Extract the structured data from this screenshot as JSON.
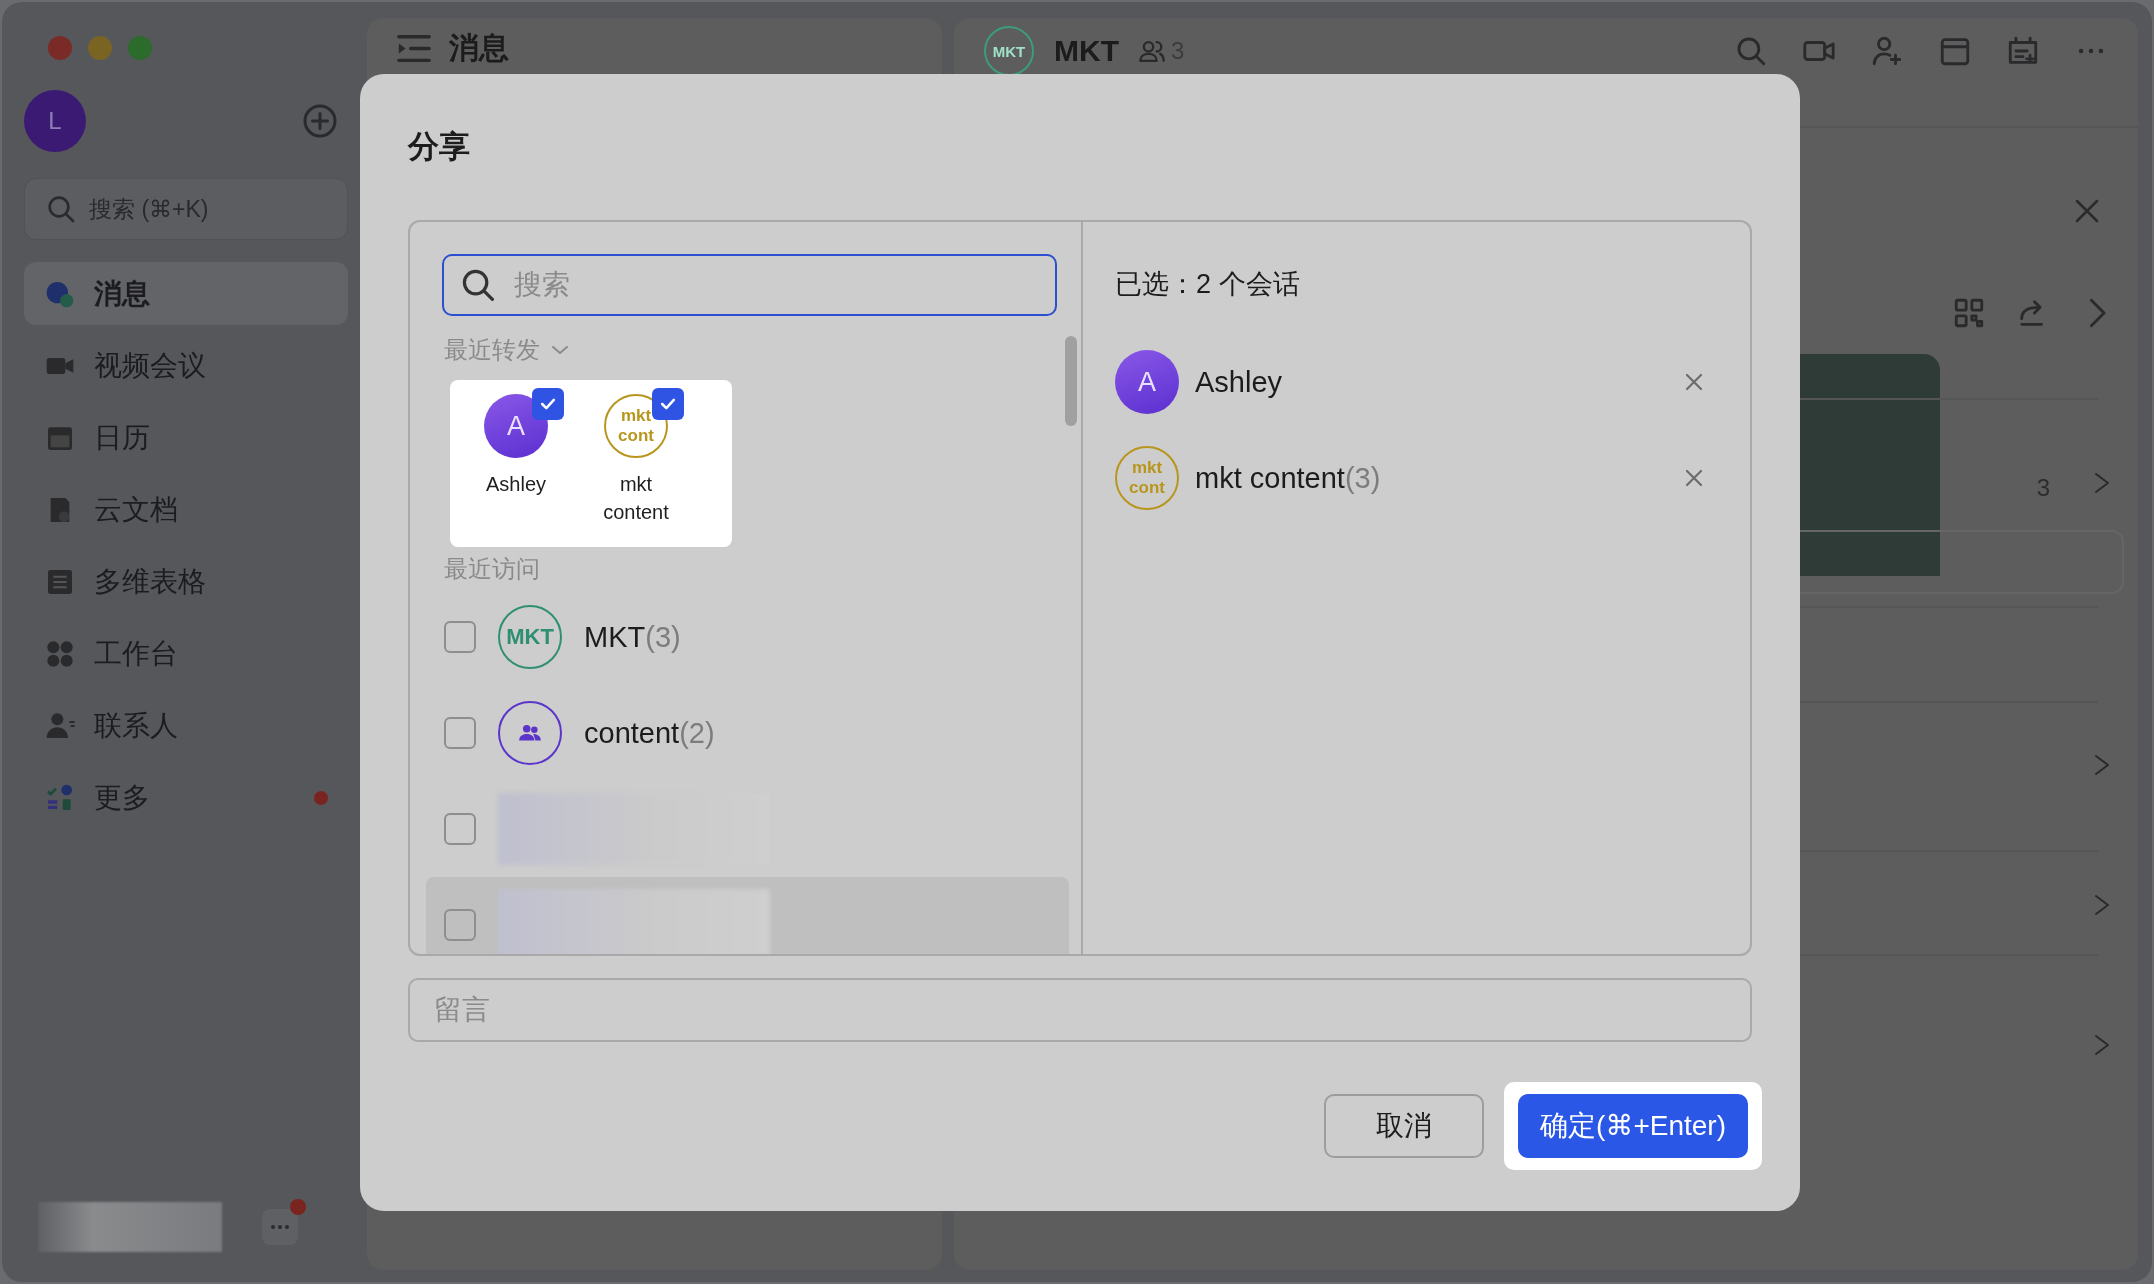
{
  "sidebar": {
    "avatar": "L",
    "search": {
      "placeholder": "搜索 (⌘+K)"
    },
    "items": [
      {
        "label": "消息",
        "selected": true,
        "unread_dot": false
      },
      {
        "label": "视频会议",
        "selected": false,
        "unread_dot": false
      },
      {
        "label": "日历",
        "selected": false,
        "unread_dot": false
      },
      {
        "label": "云文档",
        "selected": false,
        "unread_dot": false
      },
      {
        "label": "多维表格",
        "selected": false,
        "unread_dot": false
      },
      {
        "label": "工作台",
        "selected": false,
        "unread_dot": false
      },
      {
        "label": "联系人",
        "selected": false,
        "unread_dot": false
      },
      {
        "label": "更多",
        "selected": false,
        "unread_dot": true
      }
    ],
    "more_unread_dot": true
  },
  "chat_list": {
    "title": "消息"
  },
  "chat": {
    "title": "MKT",
    "member_count": "3",
    "avatar": "MKT",
    "detail_count": "3"
  },
  "dialog": {
    "title": "分享",
    "search": {
      "placeholder": "搜索"
    },
    "recent_forwards": {
      "label": "最近转发",
      "items": [
        {
          "name": "Ashley",
          "avatar": {
            "kind": "letter",
            "text": "A"
          },
          "checked": true
        },
        {
          "name": "mkt content",
          "avatar": {
            "kind": "initials",
            "text": "mkt cont",
            "color": "#b8961e"
          },
          "checked": true
        }
      ]
    },
    "recent_visits": {
      "label": "最近访问",
      "items": [
        {
          "kind": "chat",
          "name": "MKT",
          "count": "(3)",
          "avatar": {
            "kind": "initials",
            "text": "MKT",
            "color": "#2f8f72"
          },
          "checked": false,
          "hovered": false
        },
        {
          "kind": "chat",
          "name": "content",
          "count": "(2)",
          "avatar": {
            "kind": "group",
            "color": "#5b35c9"
          },
          "checked": false,
          "hovered": false
        },
        {
          "kind": "redacted",
          "checked": false,
          "hovered": false
        },
        {
          "kind": "redacted",
          "checked": false,
          "hovered": true
        }
      ]
    },
    "selected": {
      "label": "已选：2 个会话",
      "items": [
        {
          "name": "Ashley",
          "avatar": {
            "kind": "letter",
            "text": "A"
          }
        },
        {
          "name": "mkt content",
          "count": "(3)",
          "avatar": {
            "kind": "initials",
            "text": "mkt cont",
            "color": "#b8961e"
          }
        }
      ]
    },
    "message": {
      "placeholder": "留言"
    },
    "buttons": [
      {
        "kind": "secondary",
        "label": "取消"
      },
      {
        "kind": "primary",
        "label": "确定(⌘+Enter)"
      }
    ]
  }
}
